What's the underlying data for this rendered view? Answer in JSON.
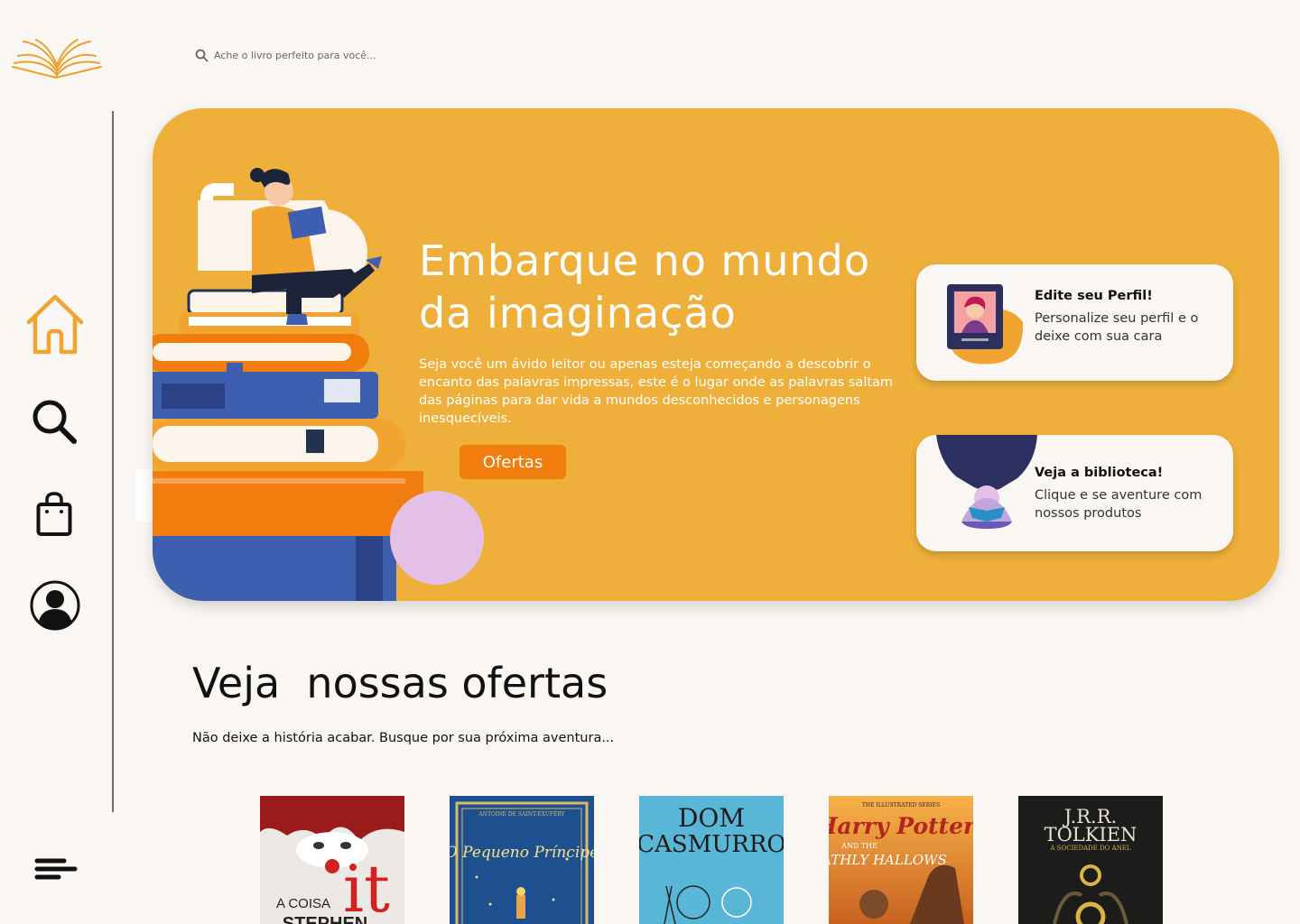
{
  "search": {
    "placeholder": "Ache o livro perfeito para você..."
  },
  "sidebar": {
    "items": [
      {
        "icon": "home-icon",
        "active": true
      },
      {
        "icon": "search-icon"
      },
      {
        "icon": "shopping-bag-icon"
      },
      {
        "icon": "user-profile-icon"
      }
    ],
    "menu_icon": "menu-icon"
  },
  "hero": {
    "title": "Embarque no mundo da imaginação",
    "description": "Seja você um ávido leitor ou apenas esteja começando a descobrir o encanto das palavras impressas, este é o lugar onde as palavras saltam das páginas para dar vida a mundos desconhecidos e personagens inesquecíveis.",
    "button_label": "Ofertas",
    "cards": [
      {
        "title": "Edite seu Perfil!",
        "text": "Personalize seu perfil e o deixe com sua cara"
      },
      {
        "title": "Veja a biblioteca!",
        "text": "Clique e se aventure com nossos produtos"
      }
    ]
  },
  "offers": {
    "title": "Veja  nossas ofertas",
    "subtitle": "Não deixe a história acabar. Busque por sua próxima aventura...",
    "books": [
      {
        "cover_text": [
          "A COISA",
          "STEPHEN"
        ],
        "big": "it"
      },
      {
        "cover_text": [
          "ANTOINE DE SAINT-EXUPÉRY",
          "O Pequeno Príncipe"
        ]
      },
      {
        "cover_text": [
          "DOM",
          "CASMURRO"
        ]
      },
      {
        "cover_text": [
          "THE ILLUSTRATED SERIES",
          "Harry Potter",
          "AND THE",
          "DEATHLY HALLOWS"
        ]
      },
      {
        "cover_text": [
          "J.R.R.",
          "TOLKIEN",
          "A SOCIEDADE DO ANEL"
        ]
      }
    ]
  },
  "colors": {
    "background": "#faf6f3",
    "hero": "#eeb03a",
    "button": "#f07d0d",
    "accent_orange": "#f2a431"
  }
}
